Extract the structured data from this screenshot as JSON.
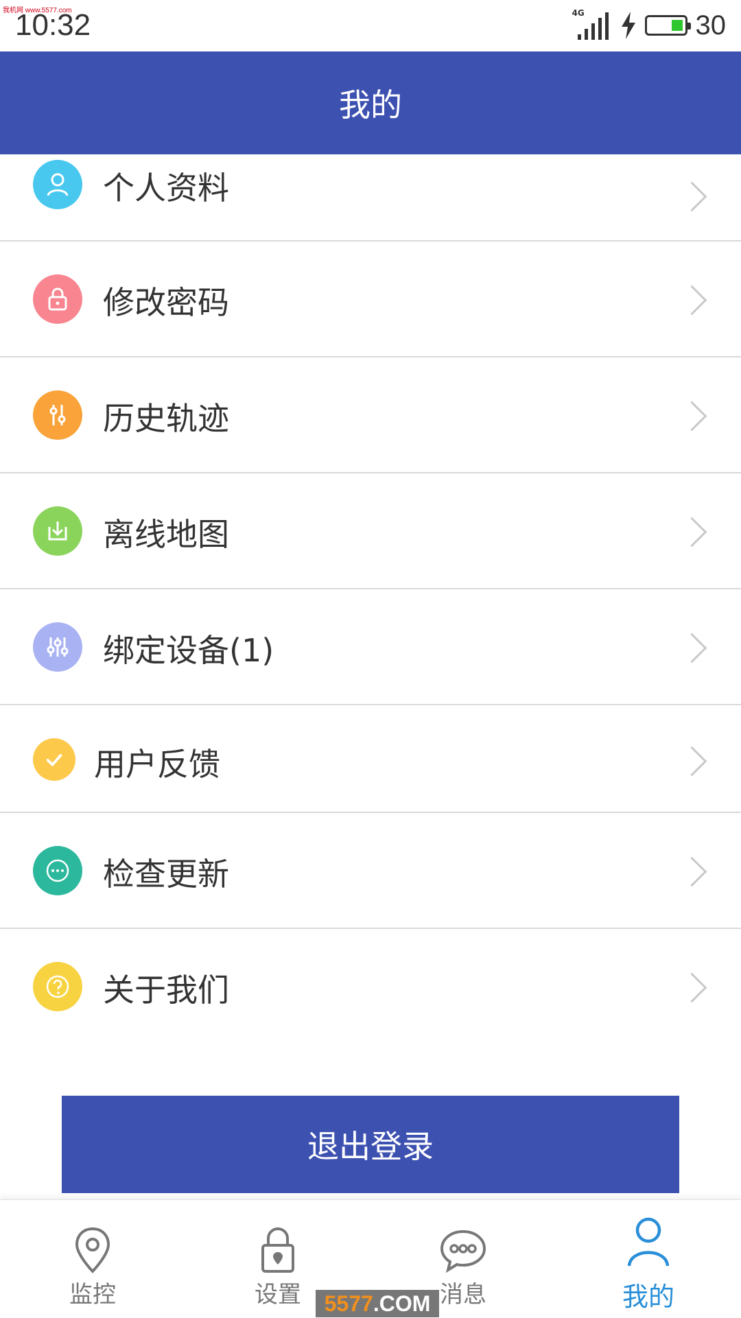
{
  "status_bar": {
    "watermark": "我机网 www.5577.com",
    "time": "10:32",
    "network": "4G",
    "battery_level": "30"
  },
  "header": {
    "title": "我的"
  },
  "menu": {
    "items": [
      {
        "label": "个人资料",
        "icon": "user-icon",
        "color": "#49c8ef"
      },
      {
        "label": "修改密码",
        "icon": "lock-icon",
        "color": "#f8858f"
      },
      {
        "label": "历史轨迹",
        "icon": "track-sliders-icon",
        "color": "#f9a33a"
      },
      {
        "label": "离线地图",
        "icon": "download-box-icon",
        "color": "#8bd45c"
      },
      {
        "label": "绑定设备(1)",
        "icon": "device-sliders-icon",
        "color": "#a9b3f3"
      },
      {
        "label": "用户反馈",
        "icon": "check-icon",
        "color": "#fdc94a"
      },
      {
        "label": "检查更新",
        "icon": "dots-circle-icon",
        "color": "#2bb89c"
      },
      {
        "label": "关于我们",
        "icon": "question-icon",
        "color": "#f8d341"
      }
    ]
  },
  "logout": {
    "label": "退出登录"
  },
  "tabbar": {
    "tabs": [
      {
        "label": "监控",
        "icon": "location-pin-icon",
        "active": false
      },
      {
        "label": "设置",
        "icon": "lock-pin-icon",
        "active": false
      },
      {
        "label": "消息",
        "icon": "chat-bubble-icon",
        "active": false
      },
      {
        "label": "我的",
        "icon": "person-icon",
        "active": true
      }
    ]
  },
  "watermark_bottom": {
    "number": "5577",
    "suffix": ".COM"
  }
}
